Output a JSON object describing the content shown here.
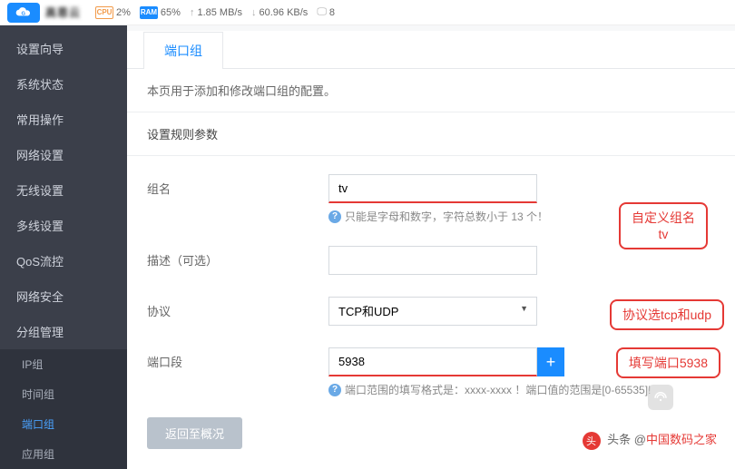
{
  "topbar": {
    "logo_text": "高恩云",
    "stats": {
      "cpu_label": "CPU",
      "cpu": "2%",
      "ram_label": "RAM",
      "ram": "65%",
      "up": "1.85 MB/s",
      "down": "60.96 KB/s",
      "clients": "8"
    }
  },
  "sidebar": {
    "items": [
      "设置向导",
      "系统状态",
      "常用操作",
      "网络设置",
      "无线设置",
      "多线设置",
      "QoS流控",
      "网络安全",
      "分组管理"
    ],
    "subs": [
      "IP组",
      "时间组",
      "端口组",
      "应用组"
    ],
    "active_sub_index": 2
  },
  "tab": {
    "label": "端口组"
  },
  "desc": "本页用于添加和修改端口组的配置。",
  "section": "设置规则参数",
  "form": {
    "group_label": "组名",
    "group_value": "tv",
    "group_hint": "只能是字母和数字，字符总数小于 13 个！",
    "desc_label": "描述（可选）",
    "desc_value": "",
    "proto_label": "协议",
    "proto_value": "TCP和UDP",
    "port_label": "端口段",
    "port_value": "5938",
    "port_hint": "端口范围的填写格式是：xxxx-xxxx ！端口值的范围是[0-65535]!"
  },
  "callouts": {
    "c1_line1": "自定义组名",
    "c1_line2": "tv",
    "c2": "协议选tcp和udp",
    "c3": "填写端口5938"
  },
  "buttons": {
    "back": "返回至概况"
  },
  "watermark": "路由器",
  "footer": {
    "prefix": "头条 @",
    "author": "中国数码之家"
  }
}
